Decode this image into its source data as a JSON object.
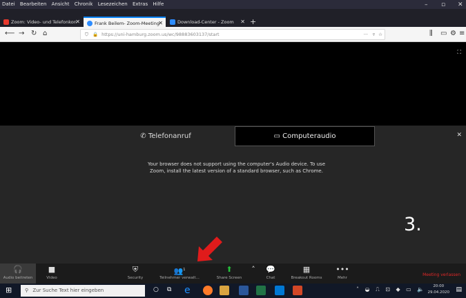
{
  "menubar": {
    "items": [
      "Datei",
      "Bearbeiten",
      "Ansicht",
      "Chronik",
      "Lesezeichen",
      "Extras",
      "Hilfe"
    ]
  },
  "tabs": [
    {
      "label": "Zoom: Video- und Telefonkon",
      "color": "#e8392d"
    },
    {
      "label": "Frank Beilem- Zoom-Meeting",
      "color": "#2d8cff"
    },
    {
      "label": "Download-Center - Zoom",
      "color": "#2d8cff"
    }
  ],
  "url": "https://uni-hamburg.zoom.us/wc/98883603137/start",
  "audio": {
    "phone_label": "Telefonanruf",
    "computer_label": "Computeraudio",
    "message": "Your browser does not support using the computer's Audio device. To use Zoom, install the latest version of a standard browser, such as Chrome."
  },
  "step_number": "3.",
  "toolbar": {
    "audio": "Audio beitreten",
    "video": "Video",
    "security": "Security",
    "participants": "Teilnehmer verwalt...",
    "participants_count": "1",
    "share": "Share Screen",
    "chat": "Chat",
    "breakout": "Breakout Rooms",
    "more": "Mehr",
    "leave": "Meeting verlassen"
  },
  "taskbar": {
    "search_placeholder": "Zur Suche Text hier eingeben",
    "time": "20:00",
    "date": "29.04.2020"
  },
  "colors": {
    "accent_blue": "#0a84ff",
    "leave_red": "#e02828",
    "share_green": "#24c23b",
    "arrow_red": "#e01b1b"
  }
}
